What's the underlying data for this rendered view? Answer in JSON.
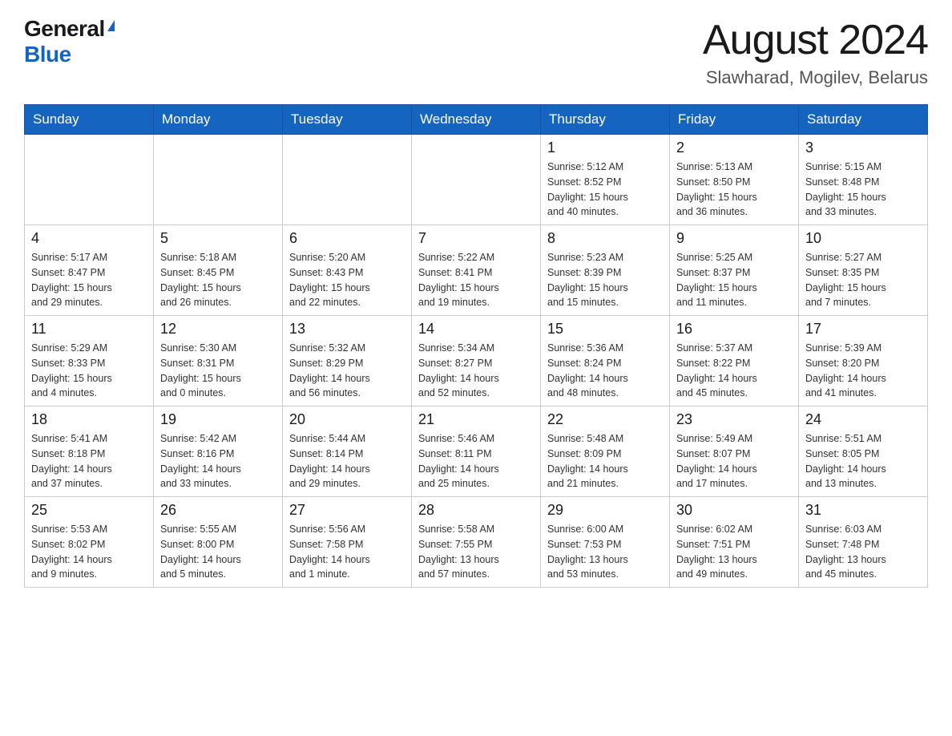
{
  "logo": {
    "general": "General",
    "blue": "Blue"
  },
  "title": "August 2024",
  "subtitle": "Slawharad, Mogilev, Belarus",
  "days_of_week": [
    "Sunday",
    "Monday",
    "Tuesday",
    "Wednesday",
    "Thursday",
    "Friday",
    "Saturday"
  ],
  "weeks": [
    [
      {
        "day": "",
        "info": ""
      },
      {
        "day": "",
        "info": ""
      },
      {
        "day": "",
        "info": ""
      },
      {
        "day": "",
        "info": ""
      },
      {
        "day": "1",
        "info": "Sunrise: 5:12 AM\nSunset: 8:52 PM\nDaylight: 15 hours\nand 40 minutes."
      },
      {
        "day": "2",
        "info": "Sunrise: 5:13 AM\nSunset: 8:50 PM\nDaylight: 15 hours\nand 36 minutes."
      },
      {
        "day": "3",
        "info": "Sunrise: 5:15 AM\nSunset: 8:48 PM\nDaylight: 15 hours\nand 33 minutes."
      }
    ],
    [
      {
        "day": "4",
        "info": "Sunrise: 5:17 AM\nSunset: 8:47 PM\nDaylight: 15 hours\nand 29 minutes."
      },
      {
        "day": "5",
        "info": "Sunrise: 5:18 AM\nSunset: 8:45 PM\nDaylight: 15 hours\nand 26 minutes."
      },
      {
        "day": "6",
        "info": "Sunrise: 5:20 AM\nSunset: 8:43 PM\nDaylight: 15 hours\nand 22 minutes."
      },
      {
        "day": "7",
        "info": "Sunrise: 5:22 AM\nSunset: 8:41 PM\nDaylight: 15 hours\nand 19 minutes."
      },
      {
        "day": "8",
        "info": "Sunrise: 5:23 AM\nSunset: 8:39 PM\nDaylight: 15 hours\nand 15 minutes."
      },
      {
        "day": "9",
        "info": "Sunrise: 5:25 AM\nSunset: 8:37 PM\nDaylight: 15 hours\nand 11 minutes."
      },
      {
        "day": "10",
        "info": "Sunrise: 5:27 AM\nSunset: 8:35 PM\nDaylight: 15 hours\nand 7 minutes."
      }
    ],
    [
      {
        "day": "11",
        "info": "Sunrise: 5:29 AM\nSunset: 8:33 PM\nDaylight: 15 hours\nand 4 minutes."
      },
      {
        "day": "12",
        "info": "Sunrise: 5:30 AM\nSunset: 8:31 PM\nDaylight: 15 hours\nand 0 minutes."
      },
      {
        "day": "13",
        "info": "Sunrise: 5:32 AM\nSunset: 8:29 PM\nDaylight: 14 hours\nand 56 minutes."
      },
      {
        "day": "14",
        "info": "Sunrise: 5:34 AM\nSunset: 8:27 PM\nDaylight: 14 hours\nand 52 minutes."
      },
      {
        "day": "15",
        "info": "Sunrise: 5:36 AM\nSunset: 8:24 PM\nDaylight: 14 hours\nand 48 minutes."
      },
      {
        "day": "16",
        "info": "Sunrise: 5:37 AM\nSunset: 8:22 PM\nDaylight: 14 hours\nand 45 minutes."
      },
      {
        "day": "17",
        "info": "Sunrise: 5:39 AM\nSunset: 8:20 PM\nDaylight: 14 hours\nand 41 minutes."
      }
    ],
    [
      {
        "day": "18",
        "info": "Sunrise: 5:41 AM\nSunset: 8:18 PM\nDaylight: 14 hours\nand 37 minutes."
      },
      {
        "day": "19",
        "info": "Sunrise: 5:42 AM\nSunset: 8:16 PM\nDaylight: 14 hours\nand 33 minutes."
      },
      {
        "day": "20",
        "info": "Sunrise: 5:44 AM\nSunset: 8:14 PM\nDaylight: 14 hours\nand 29 minutes."
      },
      {
        "day": "21",
        "info": "Sunrise: 5:46 AM\nSunset: 8:11 PM\nDaylight: 14 hours\nand 25 minutes."
      },
      {
        "day": "22",
        "info": "Sunrise: 5:48 AM\nSunset: 8:09 PM\nDaylight: 14 hours\nand 21 minutes."
      },
      {
        "day": "23",
        "info": "Sunrise: 5:49 AM\nSunset: 8:07 PM\nDaylight: 14 hours\nand 17 minutes."
      },
      {
        "day": "24",
        "info": "Sunrise: 5:51 AM\nSunset: 8:05 PM\nDaylight: 14 hours\nand 13 minutes."
      }
    ],
    [
      {
        "day": "25",
        "info": "Sunrise: 5:53 AM\nSunset: 8:02 PM\nDaylight: 14 hours\nand 9 minutes."
      },
      {
        "day": "26",
        "info": "Sunrise: 5:55 AM\nSunset: 8:00 PM\nDaylight: 14 hours\nand 5 minutes."
      },
      {
        "day": "27",
        "info": "Sunrise: 5:56 AM\nSunset: 7:58 PM\nDaylight: 14 hours\nand 1 minute."
      },
      {
        "day": "28",
        "info": "Sunrise: 5:58 AM\nSunset: 7:55 PM\nDaylight: 13 hours\nand 57 minutes."
      },
      {
        "day": "29",
        "info": "Sunrise: 6:00 AM\nSunset: 7:53 PM\nDaylight: 13 hours\nand 53 minutes."
      },
      {
        "day": "30",
        "info": "Sunrise: 6:02 AM\nSunset: 7:51 PM\nDaylight: 13 hours\nand 49 minutes."
      },
      {
        "day": "31",
        "info": "Sunrise: 6:03 AM\nSunset: 7:48 PM\nDaylight: 13 hours\nand 45 minutes."
      }
    ]
  ]
}
